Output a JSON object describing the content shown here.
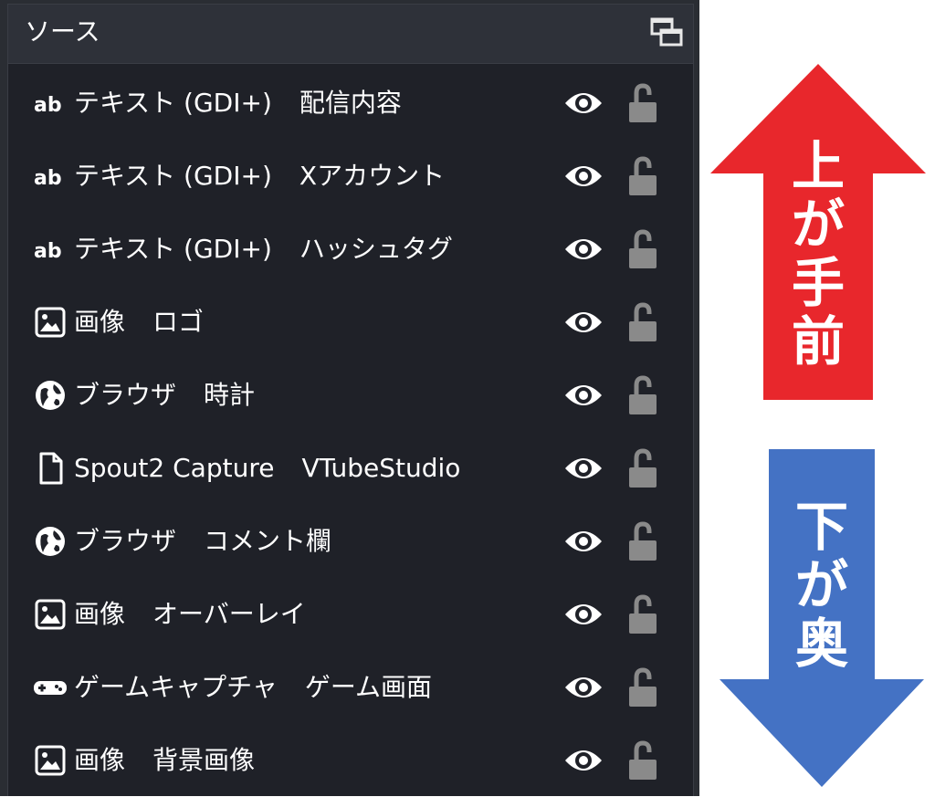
{
  "panel": {
    "title": "ソース",
    "undock_icon": "undock-icon"
  },
  "sources": [
    {
      "type_label": "テキスト (GDI+)",
      "name": "配信内容",
      "type_icon": "text-ab-icon"
    },
    {
      "type_label": "テキスト (GDI+)",
      "name": "Xアカウント",
      "type_icon": "text-ab-icon"
    },
    {
      "type_label": "テキスト (GDI+)",
      "name": "ハッシュタグ",
      "type_icon": "text-ab-icon"
    },
    {
      "type_label": "画像",
      "name": "ロゴ",
      "type_icon": "image-icon"
    },
    {
      "type_label": "ブラウザ",
      "name": "時計",
      "type_icon": "globe-icon"
    },
    {
      "type_label": "Spout2 Capture",
      "name": "VTubeStudio",
      "type_icon": "file-icon"
    },
    {
      "type_label": "ブラウザ",
      "name": "コメント欄",
      "type_icon": "globe-icon"
    },
    {
      "type_label": "画像",
      "name": "オーバーレイ",
      "type_icon": "image-icon"
    },
    {
      "type_label": "ゲームキャプチャ",
      "name": "ゲーム画面",
      "type_icon": "gamepad-icon"
    },
    {
      "type_label": "画像",
      "name": "背景画像",
      "type_icon": "image-icon"
    }
  ],
  "annotations": {
    "up_arrow": {
      "text": [
        "上",
        "が",
        "手",
        "前"
      ],
      "color": "#e8272c"
    },
    "down_arrow": {
      "text": [
        "下",
        "が",
        "奥"
      ],
      "color": "#4472c4"
    }
  },
  "colors": {
    "panel_bg": "#1f2128",
    "header_bg": "#2e3139",
    "text": "#ffffff",
    "lock": "#8a8a8a"
  }
}
